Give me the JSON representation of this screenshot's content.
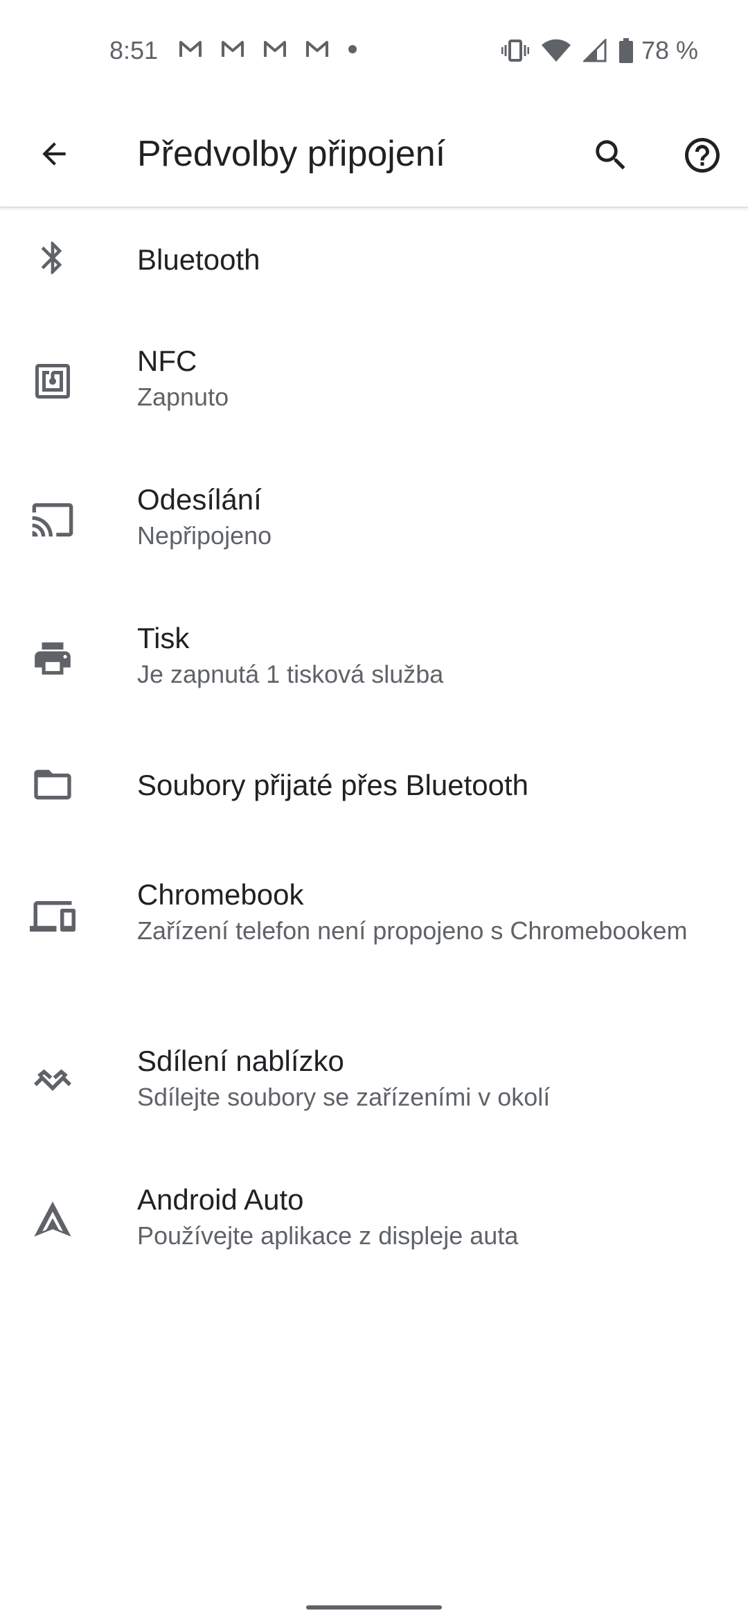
{
  "status_bar": {
    "time": "8:51",
    "notification_icons": [
      "gmail-icon",
      "gmail-icon",
      "gmail-icon",
      "gmail-icon",
      "dot-icon"
    ],
    "system_icons": [
      "vibrate-icon",
      "wifi-icon",
      "signal-icon",
      "battery-icon"
    ],
    "battery_percent": "78 %"
  },
  "app_bar": {
    "title": "Předvolby připojení",
    "back_icon": "arrow-back-icon",
    "search_icon": "search-icon",
    "help_icon": "help-icon"
  },
  "items": [
    {
      "title": "Bluetooth",
      "summary": "",
      "icon": "bluetooth-icon"
    },
    {
      "title": "NFC",
      "summary": "Zapnuto",
      "icon": "nfc-icon"
    },
    {
      "title": "Odesílání",
      "summary": "Nepřipojeno",
      "icon": "cast-icon"
    },
    {
      "title": "Tisk",
      "summary": "Je zapnutá 1 tisková služba",
      "icon": "printer-icon"
    },
    {
      "title": "Soubory přijaté přes Bluetooth",
      "summary": "",
      "icon": "folder-icon"
    },
    {
      "title": "Chromebook",
      "summary": "Zařízení telefon není propojeno s Chromebookem",
      "icon": "devices-icon"
    },
    {
      "title": "Sdílení nablízko",
      "summary": "Sdílejte soubory se zařízeními v okolí",
      "icon": "nearby-share-icon"
    },
    {
      "title": "Android Auto",
      "summary": "Používejte aplikace z displeje auta",
      "icon": "android-auto-icon"
    }
  ],
  "colors": {
    "primary_text": "#202124",
    "secondary_text": "#5f6368",
    "icon": "#5f6368",
    "background": "#ffffff"
  }
}
